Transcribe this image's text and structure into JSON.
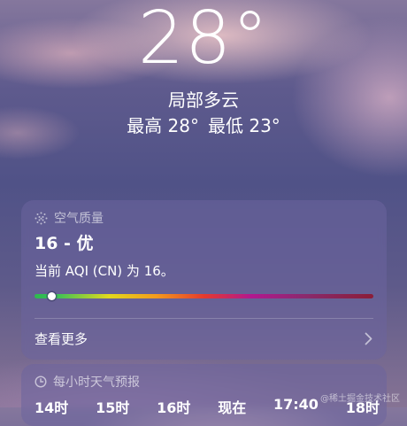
{
  "weather": {
    "temperature": "28°",
    "condition": "局部多云",
    "high": "最高 28°",
    "low": "最低 23°"
  },
  "aqi_card": {
    "title": "空气质量",
    "value": "16 - 优",
    "description": "当前 AQI (CN) 为 16。",
    "aqi_level_fraction": 0.03,
    "see_more": "查看更多"
  },
  "hourly_card": {
    "title": "每小时天气预报",
    "hours": [
      "14时",
      "15时",
      "16时",
      "现在",
      "17:40",
      "18时"
    ]
  },
  "watermark": "@稀土掘金技术社区"
}
